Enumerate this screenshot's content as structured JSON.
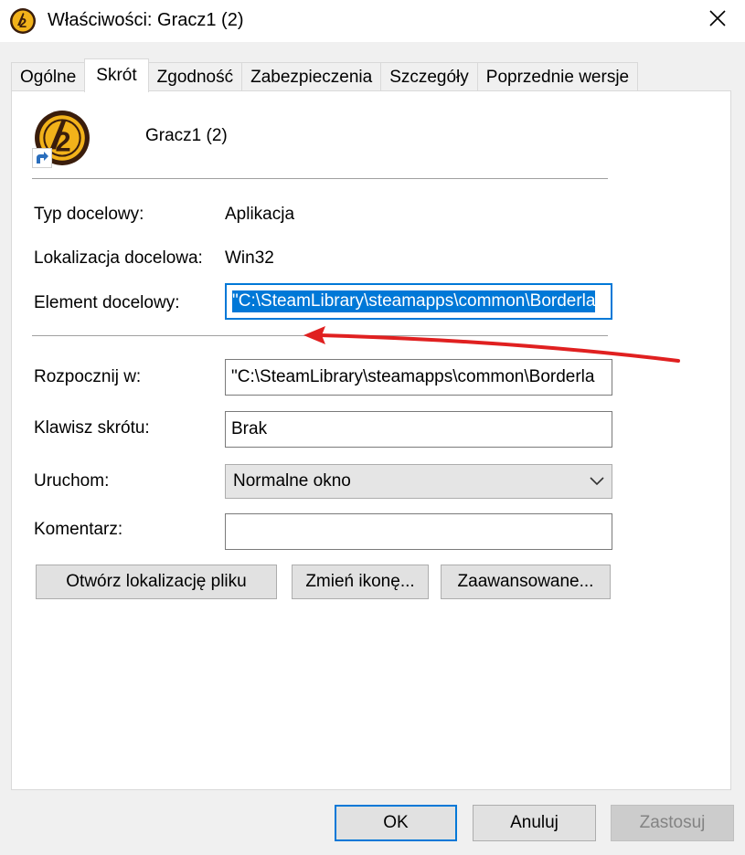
{
  "window": {
    "title": "Właściwości: Gracz1 (2)",
    "close_glyph": "✕"
  },
  "tabs": [
    {
      "label": "Ogólne"
    },
    {
      "label": "Skrót"
    },
    {
      "label": "Zgodność"
    },
    {
      "label": "Zabezpieczenia"
    },
    {
      "label": "Szczegóły"
    },
    {
      "label": "Poprzednie wersje"
    }
  ],
  "shortcut": {
    "name": "Gracz1 (2)",
    "target_type_label": "Typ docelowy:",
    "target_type_value": "Aplikacja",
    "target_location_label": "Lokalizacja docelowa:",
    "target_location_value": "Win32",
    "target_label": "Element docelowy:",
    "target_value": "\"C:\\SteamLibrary\\steamapps\\common\\Borderla",
    "start_in_label": "Rozpocznij w:",
    "start_in_value": "\"C:\\SteamLibrary\\steamapps\\common\\Borderla",
    "hotkey_label": "Klawisz skrótu:",
    "hotkey_value": "Brak",
    "run_label": "Uruchom:",
    "run_value": "Normalne okno",
    "comment_label": "Komentarz:",
    "comment_value": ""
  },
  "actions": {
    "open_location": "Otwórz lokalizację pliku",
    "change_icon": "Zmień ikonę...",
    "advanced": "Zaawansowane..."
  },
  "footer": {
    "ok": "OK",
    "cancel": "Anuluj",
    "apply": "Zastosuj"
  },
  "colors": {
    "accent": "#0078d7",
    "annotation_arrow": "#e02020",
    "icon_gold": "#f2b21a",
    "icon_dark": "#3a1d0c"
  },
  "icons": {
    "app": "game-emblem-icon",
    "shortcut_overlay": "shortcut-arrow-icon",
    "dropdown": "chevron-down-icon",
    "close": "close-icon"
  }
}
